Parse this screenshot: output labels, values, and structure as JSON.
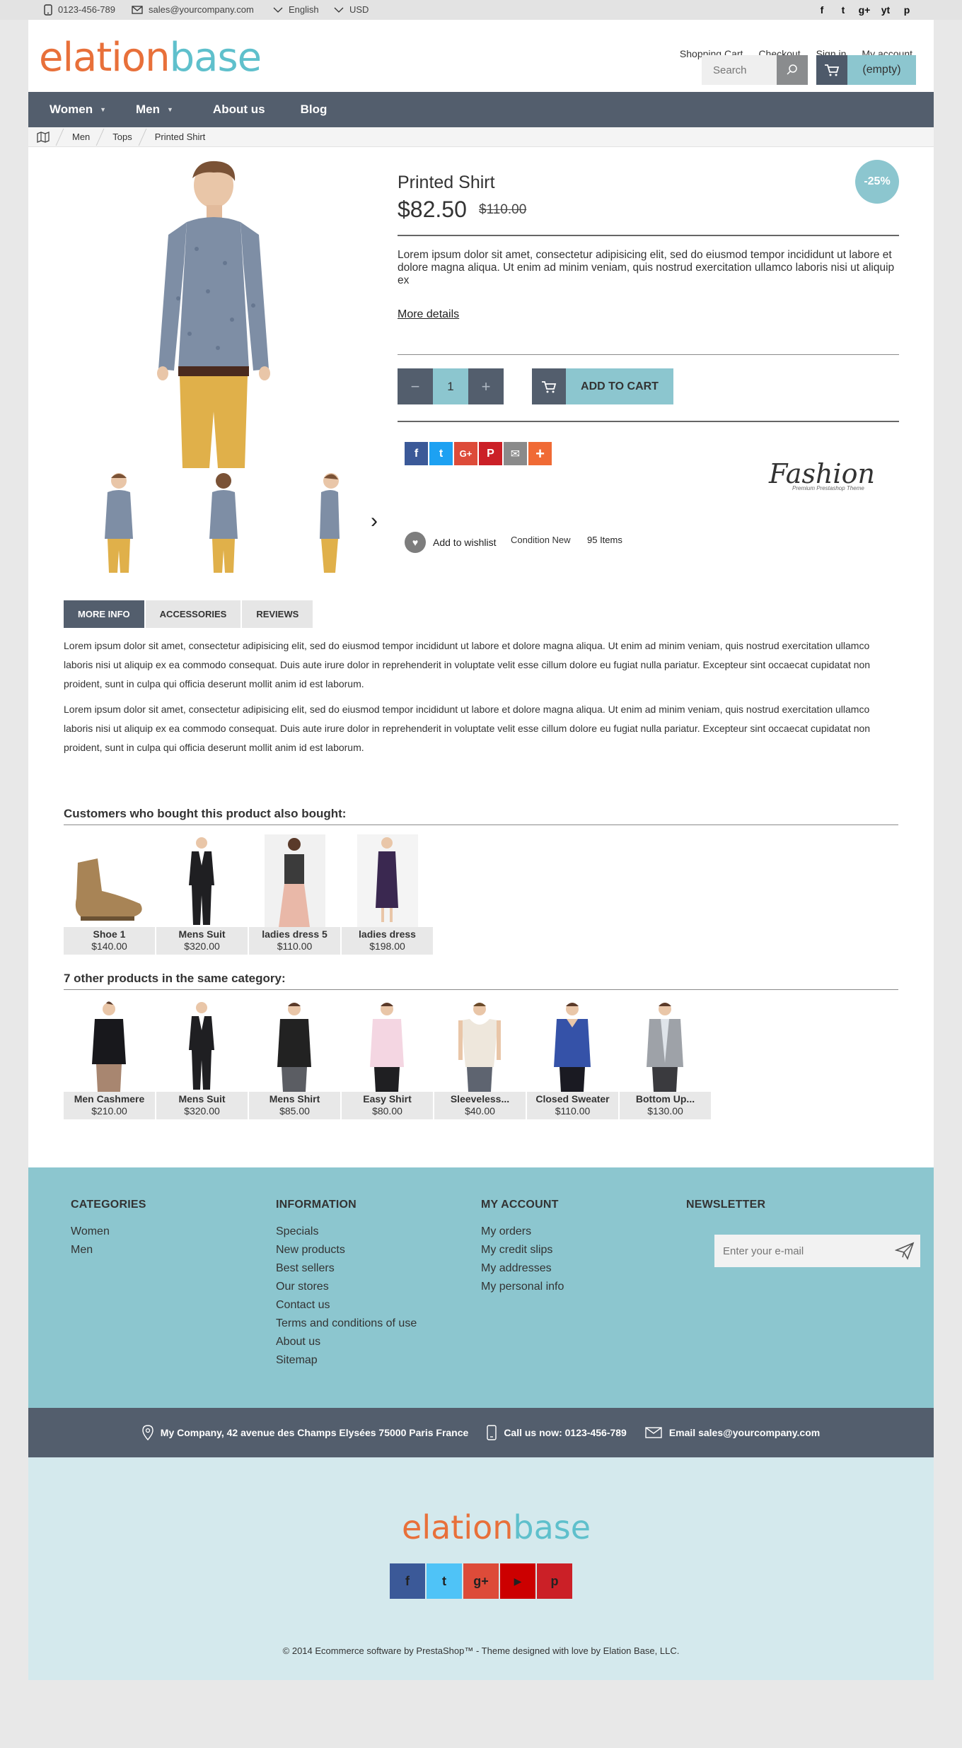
{
  "topbar": {
    "phone": "0123-456-789",
    "email": "sales@yourcompany.com",
    "language": "English",
    "currency": "USD",
    "social": [
      "f",
      "t",
      "g+",
      "yt",
      "p"
    ]
  },
  "header": {
    "links": [
      "Shopping Cart",
      "Checkout",
      "Sign in",
      "My account"
    ],
    "logo": {
      "first": "e",
      "middle": "lation",
      "last": "base"
    },
    "search_placeholder": "Search",
    "cart_label": "(empty)"
  },
  "nav": [
    {
      "label": "Women",
      "dropdown": true
    },
    {
      "label": "Men",
      "dropdown": true
    },
    {
      "label": "About us",
      "dropdown": false
    },
    {
      "label": "Blog",
      "dropdown": false
    }
  ],
  "breadcrumb": [
    "Men",
    "Tops",
    "Printed Shirt"
  ],
  "product": {
    "title": "Printed Shirt",
    "price": "$82.50",
    "old_price": "$110.00",
    "discount": "-25%",
    "description": "Lorem ipsum dolor sit amet, consectetur adipisicing elit, sed do eiusmod tempor incididunt ut labore et dolore magna aliqua. Ut enim ad minim veniam, quis nostrud exercitation ullamco laboris nisi ut aliquip ex",
    "more_details": "More details",
    "quantity": "1",
    "qty_minus": "−",
    "qty_plus": "+",
    "add_to_cart": "ADD TO CART",
    "brand": "Fashion",
    "brand_sub": "Premium Prestashop Theme",
    "wishlist": "Add to wishlist",
    "condition": "Condition New",
    "stock": "95 Items",
    "share": [
      {
        "glyph": "f",
        "color": "#3b5998"
      },
      {
        "glyph": "t",
        "color": "#1da1f2"
      },
      {
        "glyph": "G+",
        "color": "#dd4b39"
      },
      {
        "glyph": "P",
        "color": "#cb2027"
      },
      {
        "glyph": "✉",
        "color": "#8a8a8a"
      },
      {
        "glyph": "+",
        "color": "#f06a35"
      }
    ]
  },
  "tabs": [
    "MORE INFO",
    "ACCESSORIES",
    "REVIEWS"
  ],
  "more_info": [
    "Lorem ipsum dolor sit amet, consectetur adipisicing elit, sed do eiusmod tempor incididunt ut labore et dolore magna aliqua. Ut enim ad minim veniam, quis nostrud exercitation ullamco laboris nisi ut aliquip ex ea commodo consequat. Duis aute irure dolor in reprehenderit in voluptate velit esse cillum dolore eu fugiat nulla pariatur. Excepteur sint occaecat cupidatat non proident, sunt in culpa qui officia deserunt mollit anim id est laborum.",
    "Lorem ipsum dolor sit amet, consectetur adipisicing elit, sed do eiusmod tempor incididunt ut labore et dolore magna aliqua. Ut enim ad minim veniam, quis nostrud exercitation ullamco laboris nisi ut aliquip ex ea commodo consequat. Duis aute irure dolor in reprehenderit in voluptate velit esse cillum dolore eu fugiat nulla pariatur. Excepteur sint occaecat cupidatat non proident, sunt in culpa qui officia deserunt mollit anim id est laborum."
  ],
  "also_bought": {
    "title": "Customers who bought this product also bought:",
    "items": [
      {
        "name": "Shoe 1",
        "price": "$140.00"
      },
      {
        "name": "Mens Suit",
        "price": "$320.00"
      },
      {
        "name": "ladies dress 5",
        "price": "$110.00"
      },
      {
        "name": "ladies dress",
        "price": "$198.00"
      }
    ]
  },
  "same_category": {
    "title": "7 other products in the same category:",
    "items": [
      {
        "name": "Men Cashmere",
        "price": "$210.00"
      },
      {
        "name": "Mens Suit",
        "price": "$320.00"
      },
      {
        "name": "Mens Shirt",
        "price": "$85.00"
      },
      {
        "name": "Easy Shirt",
        "price": "$80.00"
      },
      {
        "name": "Sleeveless...",
        "price": "$40.00"
      },
      {
        "name": "Closed Sweater",
        "price": "$110.00"
      },
      {
        "name": "Bottom Up...",
        "price": "$130.00"
      }
    ]
  },
  "footer": {
    "categories": {
      "title": "CATEGORIES",
      "items": [
        "Women",
        "Men"
      ]
    },
    "information": {
      "title": "INFORMATION",
      "items": [
        "Specials",
        "New products",
        "Best sellers",
        "Our stores",
        "Contact us",
        "Terms and conditions of use",
        "About us",
        "Sitemap"
      ]
    },
    "account": {
      "title": "MY ACCOUNT",
      "items": [
        "My orders",
        "My credit slips",
        "My addresses",
        "My personal info"
      ]
    },
    "newsletter": {
      "title": "NEWSLETTER",
      "placeholder": "Enter your e-mail"
    },
    "address": "My Company, 42 avenue des Champs Elysées 75000 Paris France",
    "call": "Call us now: 0123-456-789",
    "email": "Email sales@yourcompany.com",
    "social": [
      {
        "glyph": "f",
        "color": "#3b5998"
      },
      {
        "glyph": "t",
        "color": "#4fc3f7"
      },
      {
        "glyph": "g+",
        "color": "#dd4b39"
      },
      {
        "glyph": "▶",
        "color": "#cc0000"
      },
      {
        "glyph": "p",
        "color": "#cb2027"
      }
    ],
    "copyright": "© 2014 Ecommerce software by PrestaShop™ - Theme designed with love by Elation Base, LLC."
  }
}
